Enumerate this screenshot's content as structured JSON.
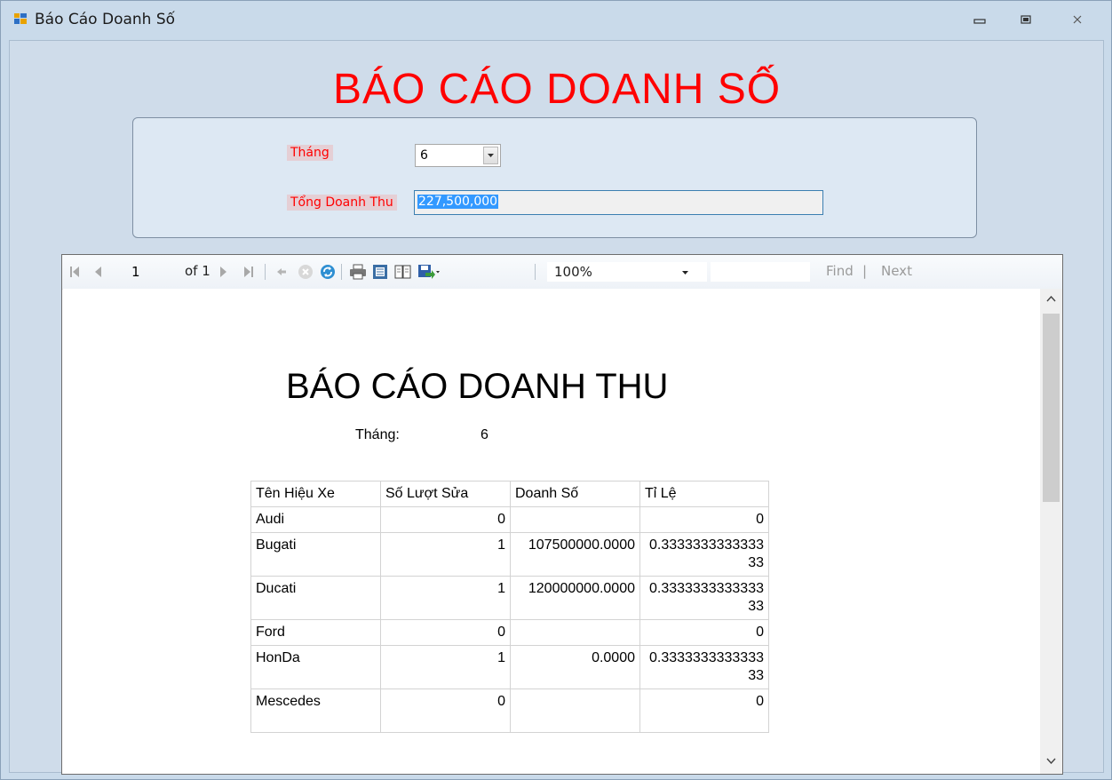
{
  "window": {
    "title": "Báo Cáo Doanh Số"
  },
  "form": {
    "heading": "BÁO CÁO DOANH SỐ",
    "month_label": "Tháng",
    "month_value": "6",
    "revenue_label": "Tổng Doanh Thu",
    "revenue_value": "227,500,000"
  },
  "toolbar": {
    "page_current": "1",
    "page_of": "of 1",
    "zoom": "100%",
    "find_label": "Find",
    "separator": "|",
    "next_label": "Next"
  },
  "report": {
    "title": "BÁO CÁO DOANH THU",
    "month_label": "Tháng:",
    "month_value": "6",
    "headers": [
      "Tên Hiệu Xe",
      "Số Lượt Sửa",
      "Doanh Số",
      "Tỉ Lệ"
    ],
    "rows": [
      [
        "Audi",
        "0",
        "",
        "0"
      ],
      [
        "Bugati",
        "1",
        "107500000.0000",
        "0.333333333333333"
      ],
      [
        "Ducati",
        "1",
        "120000000.0000",
        "0.333333333333333"
      ],
      [
        "Ford",
        "0",
        "",
        "0"
      ],
      [
        "HonDa",
        "1",
        "0.0000",
        "0.333333333333333"
      ],
      [
        "Mescedes",
        "0",
        "",
        "0"
      ]
    ]
  }
}
